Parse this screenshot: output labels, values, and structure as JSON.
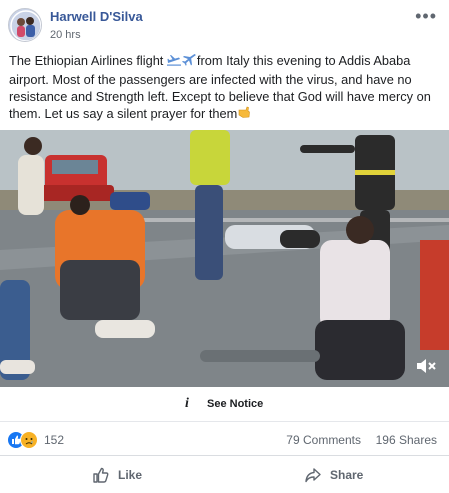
{
  "post": {
    "author": "Harwell D'Silva",
    "time": "20 hrs",
    "more_icon": "more-horizontal-icon",
    "text_before_emoji": "The Ethiopian Airlines flight ",
    "text_after_emoji": "from Italy this evening to Addis Ababa airport. Most of the passengers are infected with the virus, and have no resistance and Strength left. Except to believe that God will have mercy on them. Let us say a silent prayer for them",
    "emojis": [
      "airplane-departure-icon",
      "airplane-icon",
      "pointing-hand-icon"
    ]
  },
  "video": {
    "description_icon": "video-thumbnail",
    "mute_icon": "speaker-muted-icon"
  },
  "notice": {
    "label": "See Notice",
    "icon": "info-icon"
  },
  "stats": {
    "reactions": [
      "like-reaction-icon",
      "sad-reaction-icon"
    ],
    "reaction_count": "152",
    "comments": "79 Comments",
    "shares": "196 Shares"
  },
  "actions": {
    "like_label": "Like",
    "share_label": "Share"
  },
  "colors": {
    "author": "#385898",
    "meta": "#606770",
    "like_blue": "#1877f2",
    "sad_yellow": "#f7b125"
  }
}
